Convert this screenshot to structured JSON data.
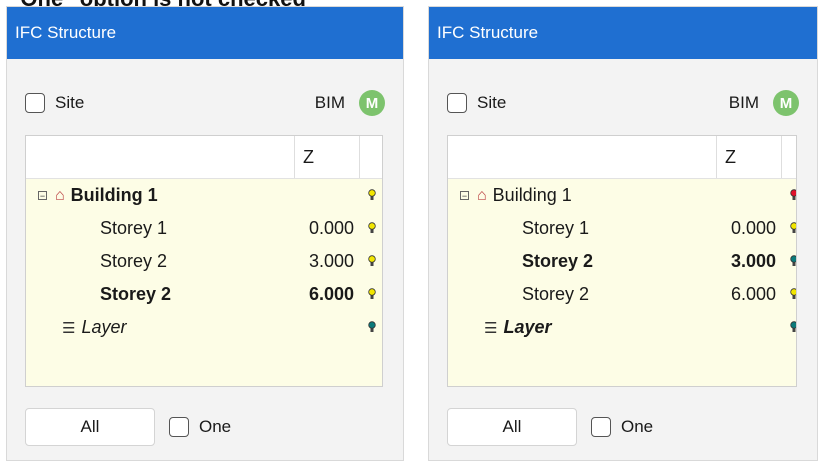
{
  "caption": "\"One\" option is not checked",
  "colors": {
    "titlebar": "#1f6fd1",
    "bulb_yellow": "#f2e600",
    "bulb_teal": "#0b7a7a",
    "bulb_red": "#e0102a",
    "badge": "#7dc36d"
  },
  "panels": [
    {
      "title": "IFC Structure",
      "site_label": "Site",
      "bim_label": "BIM",
      "badge_letter": "M",
      "z_header": "Z",
      "all_button": "All",
      "one_label": "One",
      "rows": [
        {
          "label": "Building 1",
          "z": "",
          "bulb": "yellow",
          "bold": true,
          "italic": false,
          "kind": "building"
        },
        {
          "label": "Storey 1",
          "z": "0.000",
          "bulb": "yellow",
          "bold": false,
          "italic": false,
          "kind": "storey"
        },
        {
          "label": "Storey 2",
          "z": "3.000",
          "bulb": "yellow",
          "bold": false,
          "italic": false,
          "kind": "storey"
        },
        {
          "label": "Storey 2",
          "z": "6.000",
          "bulb": "yellow",
          "bold": true,
          "italic": false,
          "kind": "storey"
        },
        {
          "label": "Layer",
          "z": "",
          "bulb": "teal",
          "bold": false,
          "italic": true,
          "kind": "layer"
        }
      ]
    },
    {
      "title": "IFC Structure",
      "site_label": "Site",
      "bim_label": "BIM",
      "badge_letter": "M",
      "z_header": "Z",
      "all_button": "All",
      "one_label": "One",
      "rows": [
        {
          "label": "Building 1",
          "z": "",
          "bulb": "red",
          "bold": false,
          "italic": false,
          "kind": "building"
        },
        {
          "label": "Storey 1",
          "z": "0.000",
          "bulb": "yellow",
          "bold": false,
          "italic": false,
          "kind": "storey"
        },
        {
          "label": "Storey 2",
          "z": "3.000",
          "bulb": "teal",
          "bold": true,
          "italic": false,
          "kind": "storey"
        },
        {
          "label": "Storey 2",
          "z": "6.000",
          "bulb": "yellow",
          "bold": false,
          "italic": false,
          "kind": "storey"
        },
        {
          "label": "Layer",
          "z": "",
          "bulb": "teal",
          "bold": true,
          "italic": true,
          "kind": "layer"
        }
      ]
    }
  ]
}
